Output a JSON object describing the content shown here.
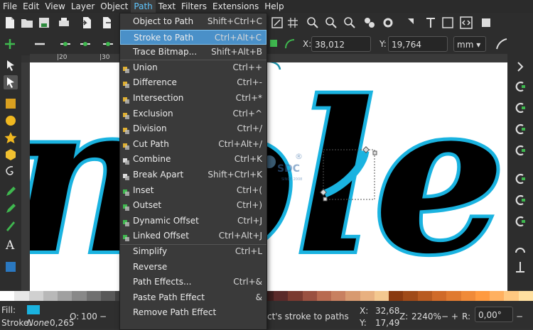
{
  "menubar": [
    "File",
    "Edit",
    "View",
    "Layer",
    "Object",
    "Path",
    "Text",
    "Filters",
    "Extensions",
    "Help"
  ],
  "menubar_active": "Path",
  "path_menu": [
    {
      "label": "Object to Path",
      "shortcut": "Shift+Ctrl+C",
      "icon": "",
      "sep_after": false
    },
    {
      "label": "Stroke to Path",
      "shortcut": "Ctrl+Alt+C",
      "icon": "",
      "highlight": true,
      "sep_after": false
    },
    {
      "label": "Trace Bitmap...",
      "shortcut": "Shift+Alt+B",
      "icon": "",
      "sep_after": true
    },
    {
      "label": "Union",
      "shortcut": "Ctrl++",
      "icon": "union-icon"
    },
    {
      "label": "Difference",
      "shortcut": "Ctrl+-",
      "icon": "difference-icon"
    },
    {
      "label": "Intersection",
      "shortcut": "Ctrl+*",
      "icon": "intersection-icon"
    },
    {
      "label": "Exclusion",
      "shortcut": "Ctrl+^",
      "icon": "exclusion-icon"
    },
    {
      "label": "Division",
      "shortcut": "Ctrl+/",
      "icon": "division-icon"
    },
    {
      "label": "Cut Path",
      "shortcut": "Ctrl+Alt+/",
      "icon": "cut-path-icon"
    },
    {
      "label": "Combine",
      "shortcut": "Ctrl+K",
      "icon": "combine-icon"
    },
    {
      "label": "Break Apart",
      "shortcut": "Shift+Ctrl+K",
      "icon": "break-apart-icon"
    },
    {
      "label": "Inset",
      "shortcut": "Ctrl+(",
      "icon": "inset-icon"
    },
    {
      "label": "Outset",
      "shortcut": "Ctrl+)",
      "icon": "outset-icon"
    },
    {
      "label": "Dynamic Offset",
      "shortcut": "Ctrl+J",
      "icon": "dynamic-offset-icon"
    },
    {
      "label": "Linked Offset",
      "shortcut": "Ctrl+Alt+J",
      "icon": "linked-offset-icon",
      "sep_after": true
    },
    {
      "label": "Simplify",
      "shortcut": "Ctrl+L",
      "icon": ""
    },
    {
      "label": "Reverse",
      "shortcut": "",
      "icon": ""
    },
    {
      "label": "Path Effects...",
      "shortcut": "Ctrl+&",
      "icon": ""
    },
    {
      "label": "Paste Path Effect",
      "shortcut": "&",
      "icon": ""
    },
    {
      "label": "Remove Path Effect",
      "shortcut": "",
      "icon": ""
    }
  ],
  "toolbar": {
    "x_label": "X:",
    "x_value": "38,012",
    "y_label": "Y:",
    "y_value": "19,764",
    "unit": "mm"
  },
  "ruler_top": [
    "|20",
    "|30"
  ],
  "canvas_text": "nole",
  "watermark": {
    "brand": "SDC",
    "since": "SINCE 2008",
    "mark": "®"
  },
  "status": {
    "fill_label": "Fill:",
    "stroke_label": "Stroke:",
    "stroke_value": "None",
    "stroke_width": "0,265",
    "opacity_label": "O:",
    "opacity_value": "100",
    "message": "ct's stroke to paths",
    "cx_label": "X:",
    "cx_value": "32,68",
    "cy_label": "Y:",
    "cy_value": "17,49",
    "zoom_label": "Z:",
    "zoom_value": "2240%",
    "rot_label": "R:",
    "rot_value": "0,00°"
  },
  "colors": {
    "accent": "#4a90c8",
    "fill_swatch": "#1ab3e0",
    "stroke_blue": "#1ab3e0",
    "menu_active_text": "#5fc7ff"
  },
  "palette": [
    "#ffffff",
    "#e8e8e8",
    "#d0d0d0",
    "#b8b8b8",
    "#a0a0a0",
    "#888",
    "#707070",
    "#585858",
    "#404040",
    "#282828",
    "#000",
    "#800000",
    "#a00000",
    "#c03030",
    "#e06060",
    "#f09090",
    "#f8c0c0",
    "#fde0e0",
    "#3d1f1f",
    "#5a2a2a",
    "#7a3a30",
    "#9a5040",
    "#b86a50",
    "#c88060",
    "#d89a70",
    "#e8b080",
    "#f4c890",
    "#8a3a10",
    "#a04a18",
    "#b85a20",
    "#d06a28",
    "#e07a30",
    "#f08a38",
    "#ff9a40",
    "#ffb060",
    "#ffc880",
    "#ffe0a0"
  ]
}
